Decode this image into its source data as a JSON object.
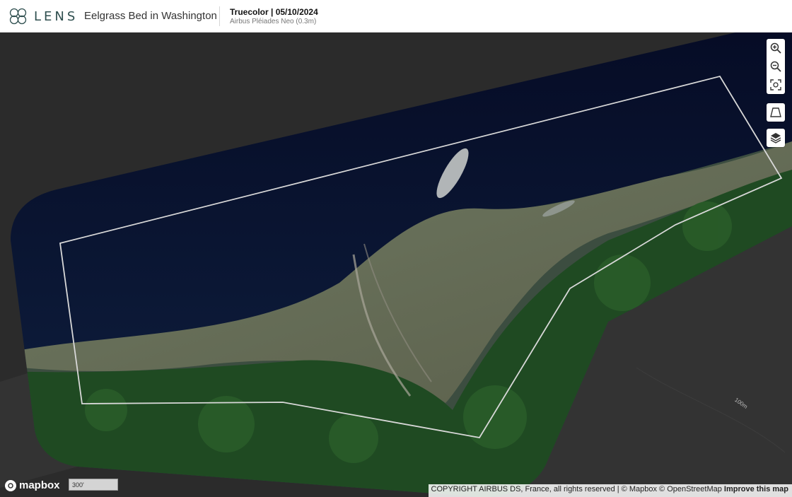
{
  "header": {
    "logo_text": "LENS",
    "project_title": "Eelgrass Bed in Washington",
    "layer_title": "Truecolor | 05/10/2024",
    "layer_subtitle": "Airbus Pléiades Neo (0.3m)"
  },
  "map": {
    "basemap_label": "mapbox",
    "scale_label": "300'",
    "contour_label": "100m",
    "attribution_text": "COPYRIGHT AIRBUS DS, France, all rights reserved | © Mapbox © OpenStreetMap",
    "improve_link": "Improve this map",
    "controls": [
      "zoom-in-icon",
      "zoom-out-icon",
      "fit-bounds-icon",
      "draw-polygon-icon",
      "layers-icon"
    ]
  },
  "colors": {
    "water": "#0b1436",
    "forest": "#1f4a22",
    "beach": "#7c7d66",
    "aoi_outline": "#d8d8d8",
    "background": "#2b2b2b"
  }
}
